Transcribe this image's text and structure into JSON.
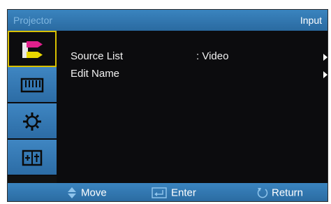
{
  "titlebar": {
    "app_name": "Projector",
    "menu_name": "Input"
  },
  "sidebar": {
    "items": [
      {
        "name": "input",
        "icon": "input-source-icon",
        "active": true
      },
      {
        "name": "picture",
        "icon": "keyboard-icon",
        "active": false
      },
      {
        "name": "setup",
        "icon": "gear-icon",
        "active": false
      },
      {
        "name": "option",
        "icon": "option-panel-icon",
        "active": false
      }
    ]
  },
  "menu": {
    "items": [
      {
        "label": "Source List",
        "value": ": Video",
        "has_submenu": true
      },
      {
        "label": "Edit Name",
        "value": "",
        "has_submenu": true
      }
    ]
  },
  "footer": {
    "move_label": "Move",
    "enter_label": "Enter",
    "return_label": "Return"
  },
  "colors": {
    "bar_blue": "#3a84bf",
    "active_border": "#d8c000",
    "background": "#0c0c0e"
  }
}
